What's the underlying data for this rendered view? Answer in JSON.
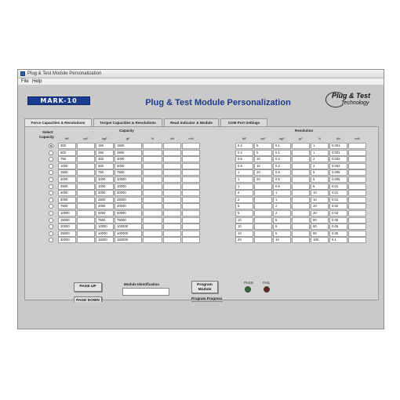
{
  "window": {
    "title": "Plug & Test Module Personalization",
    "menu": [
      "File",
      "Help"
    ]
  },
  "header": {
    "logo_text": "MARK-10",
    "title": "Plug & Test Module Personalization",
    "pt_logo_line1": "Plug & Test",
    "pt_logo_line2": "Technology"
  },
  "tabs": [
    {
      "label": "Force Capacities & Resolutions",
      "active": true
    },
    {
      "label": "Torque Capacities & Resolutions",
      "active": false
    },
    {
      "label": "Read Indicator & Module",
      "active": false
    },
    {
      "label": "COM Port Settings",
      "active": false
    }
  ],
  "table": {
    "select_label_1": "Select",
    "select_label_2": "Capacity",
    "capacity_title": "Capacity",
    "resolution_title": "Resolution",
    "capacity_units": [
      "lbF",
      "ozF",
      "kgF",
      "gF",
      "N",
      "kN",
      "mN"
    ],
    "resolution_units": [
      "lbF",
      "ozF",
      "kgF",
      "gF",
      "N",
      "kN",
      "mN"
    ],
    "selected_row": 0,
    "capacity_rows": [
      [
        "300",
        "",
        "150",
        "1500",
        "",
        "",
        ""
      ],
      [
        "500",
        "",
        "250",
        "2500",
        "",
        "",
        ""
      ],
      [
        "750",
        "",
        "400",
        "4000",
        "",
        "",
        ""
      ],
      [
        "1000",
        "",
        "500",
        "5000",
        "",
        "",
        ""
      ],
      [
        "1500",
        "",
        "750",
        "7500",
        "",
        "",
        ""
      ],
      [
        "2000",
        "",
        "1000",
        "10000",
        "",
        "",
        ""
      ],
      [
        "2500",
        "",
        "1000",
        "10000",
        "",
        "",
        ""
      ],
      [
        "4000",
        "",
        "2000",
        "20000",
        "",
        "",
        ""
      ],
      [
        "5000",
        "",
        "2500",
        "25000",
        "",
        "",
        ""
      ],
      [
        "7500",
        "",
        "4000",
        "40000",
        "",
        "",
        ""
      ],
      [
        "10000",
        "",
        "5000",
        "50000",
        "",
        "",
        ""
      ],
      [
        "15000",
        "",
        "7500",
        "75000",
        "",
        "",
        ""
      ],
      [
        "20000",
        "",
        "10000",
        "100000",
        "",
        "",
        ""
      ],
      [
        "25000",
        "",
        "10000",
        "100000",
        "",
        "",
        ""
      ],
      [
        "30000",
        "",
        "15000",
        "150000",
        "",
        "",
        ""
      ]
    ],
    "resolution_rows": [
      [
        "0.2",
        "5",
        "0.1",
        "",
        "1",
        "0.001",
        ""
      ],
      [
        "0.2",
        "5",
        "0.1",
        "",
        "1",
        "0.001",
        ""
      ],
      [
        "0.5",
        "10",
        "0.2",
        "",
        "2",
        "0.002",
        ""
      ],
      [
        "0.5",
        "10",
        "0.2",
        "",
        "2",
        "0.002",
        ""
      ],
      [
        "1",
        "20",
        "0.5",
        "",
        "5",
        "0.005",
        ""
      ],
      [
        "1",
        "20",
        "0.5",
        "",
        "5",
        "0.005",
        ""
      ],
      [
        "1",
        "",
        "0.5",
        "",
        "5",
        "0.01",
        ""
      ],
      [
        "2",
        "",
        "1",
        "",
        "10",
        "0.01",
        ""
      ],
      [
        "2",
        "",
        "1",
        "",
        "10",
        "0.01",
        ""
      ],
      [
        "5",
        "",
        "2",
        "",
        "20",
        "0.02",
        ""
      ],
      [
        "5",
        "",
        "2",
        "",
        "20",
        "0.02",
        ""
      ],
      [
        "10",
        "",
        "5",
        "",
        "50",
        "0.05",
        ""
      ],
      [
        "10",
        "",
        "5",
        "",
        "50",
        "0.05",
        ""
      ],
      [
        "10",
        "",
        "5",
        "",
        "50",
        "0.05",
        ""
      ],
      [
        "20",
        "",
        "10",
        "",
        "100",
        "0.1",
        ""
      ]
    ]
  },
  "controls": {
    "page_up": "PAGE UP",
    "page_down": "PAGE DOWN",
    "module_id_label": "Module Identification",
    "module_id_value": "",
    "program_module": "Program Module",
    "program_progress_label": "Program Progress",
    "pass_label": "PASS",
    "fail_label": "FAIL",
    "pass_color": "#2f6b2f",
    "fail_color": "#6b2020"
  }
}
